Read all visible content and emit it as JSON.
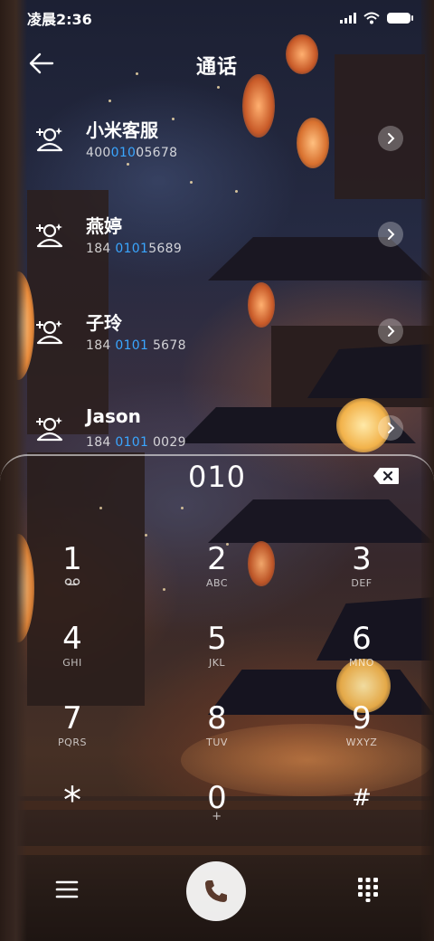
{
  "status_bar": {
    "time": "凌晨2:36",
    "icons": [
      "signal-icon",
      "wifi-icon",
      "battery-icon"
    ]
  },
  "header": {
    "title": "通话",
    "back_icon": "back-arrow-icon"
  },
  "search_query": "010",
  "highlight_color": "#3aa6ff",
  "contacts": [
    {
      "name": "小米客服",
      "number_pre": "400",
      "number_match": "010",
      "number_post": "05678"
    },
    {
      "name": "燕婷",
      "number_pre": "184 ",
      "number_match": "0101",
      "number_post": "5689"
    },
    {
      "name": "子玲",
      "number_pre": "184 ",
      "number_match": "0101",
      "number_post": " 5678"
    },
    {
      "name": "Jason",
      "number_pre": "184 ",
      "number_match": "0101",
      "number_post": " 0029"
    }
  ],
  "dialpad": {
    "keys": [
      {
        "digit": "1",
        "letters": ""
      },
      {
        "digit": "2",
        "letters": "ABC"
      },
      {
        "digit": "3",
        "letters": "DEF"
      },
      {
        "digit": "4",
        "letters": "GHI"
      },
      {
        "digit": "5",
        "letters": "JKL"
      },
      {
        "digit": "6",
        "letters": "MNO"
      },
      {
        "digit": "7",
        "letters": "PQRS"
      },
      {
        "digit": "8",
        "letters": "TUV"
      },
      {
        "digit": "9",
        "letters": "WXYZ"
      },
      {
        "digit": "*",
        "letters": ""
      },
      {
        "digit": "0",
        "letters": "+"
      },
      {
        "digit": "#",
        "letters": ""
      }
    ]
  },
  "bottom_bar": {
    "icons": [
      "menu-icon",
      "phone-icon",
      "dialpad-icon"
    ]
  }
}
